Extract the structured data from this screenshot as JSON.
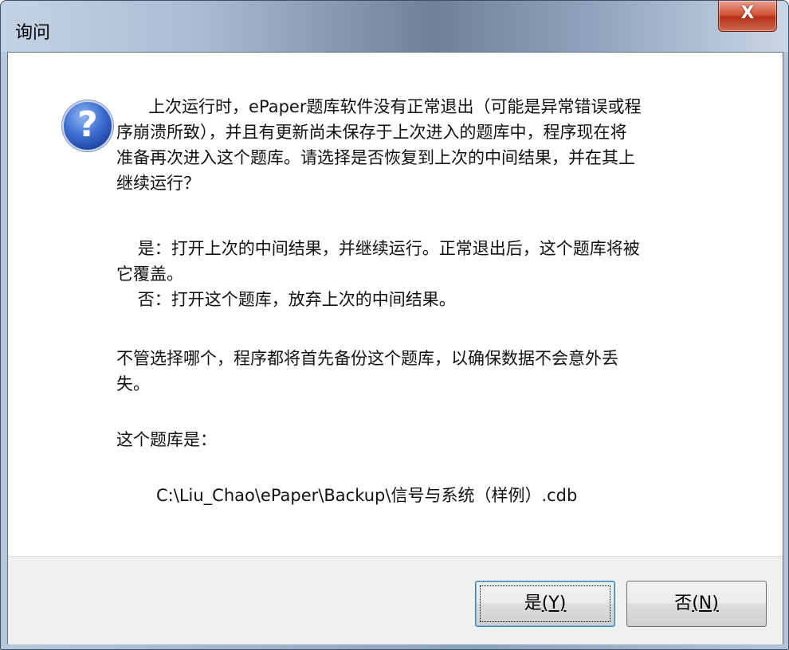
{
  "window": {
    "title": "询问",
    "close_glyph": "X"
  },
  "icon": {
    "name": "question-icon",
    "glyph": "?"
  },
  "message": {
    "paragraph1": "      上次运行时，ePaper题库软件没有正常退出（可能是异常错误或程\n序崩溃所致），并且有更新尚未保存于上次进入的题库中，程序现在将\n准备再次进入这个题库。请选择是否恢复到上次的中间结果，并在其上\n继续运行？",
    "paragraph2": "    是：打开上次的中间结果，并继续运行。正常退出后，这个题库将被\n它覆盖。\n    否：打开这个题库，放弃上次的中间结果。",
    "paragraph3": "不管选择哪个，程序都将首先备份这个题库，以确保数据不会意外丢\n失。",
    "paragraph4": "这个题库是：",
    "path": "C:\\Liu_Chao\\ePaper\\Backup\\信号与系统（样例）.cdb"
  },
  "buttons": {
    "yes": {
      "label": "是",
      "accel": "(Y)"
    },
    "no": {
      "label": "否",
      "accel": "(N)"
    }
  },
  "colors": {
    "close_button": "#c8472d",
    "question_icon": "#2f5fc4",
    "default_button_border": "#3c7fb1"
  }
}
